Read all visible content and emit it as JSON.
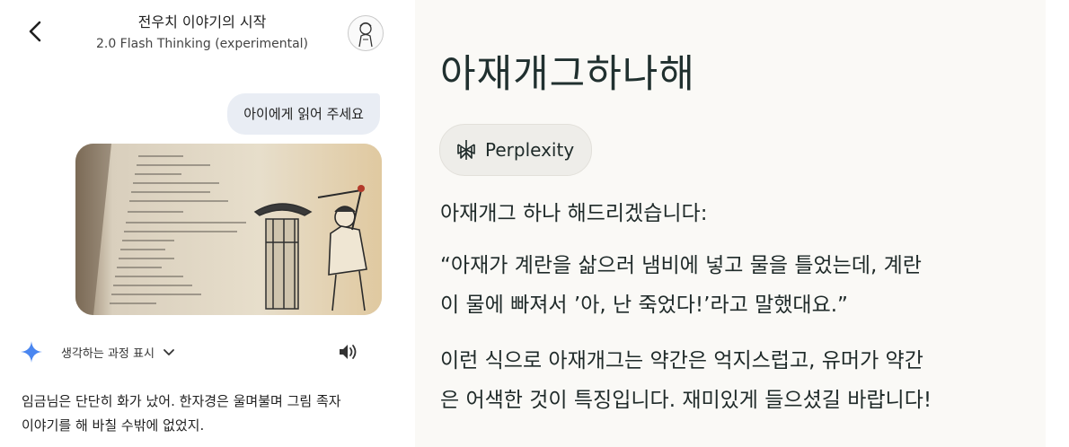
{
  "left_panel": {
    "header": {
      "title": "전우치 이야기의 시작",
      "subtitle": "2.0 Flash Thinking (experimental)"
    },
    "icons": {
      "back": "chevron-left-icon",
      "avatar": "user-avatar",
      "sparkle": "gemini-sparkle-icon",
      "chevron": "chevron-down-icon",
      "speaker": "speaker-icon"
    },
    "user_message": "아이에게 읽어 주세요",
    "thinking_label": "생각하는 과정 표시",
    "response_lines": [
      "임금님은 단단히 화가 났어. 한자경은 울며불며 그림 족자",
      "이야기를 해 바칠 수밖에 없었지."
    ],
    "colors": {
      "bubble": "#e9edf4",
      "sparkle": "#4a86f0"
    }
  },
  "right_panel": {
    "title": "아재개그하나해",
    "source_chip": "Perplexity",
    "paragraph1": "아재개그 하나 해드리겠습니다:",
    "paragraph2_lines": [
      "“아재가 계란을 삶으러 냄비에 넣고 물을 틀었는데, 계란",
      "이 물에 빠져서 ’아, 난 죽었다!’라고 말했대요.”"
    ],
    "paragraph3_lines": [
      "이런 식으로 아재개그는 약간은 억지스럽고, 유머가 약간",
      "은 어색한 것이 특징입니다. 재미있게 들으셨길 바랍니다!"
    ],
    "colors": {
      "background": "#faf9f6",
      "text": "#1f2a29"
    }
  }
}
